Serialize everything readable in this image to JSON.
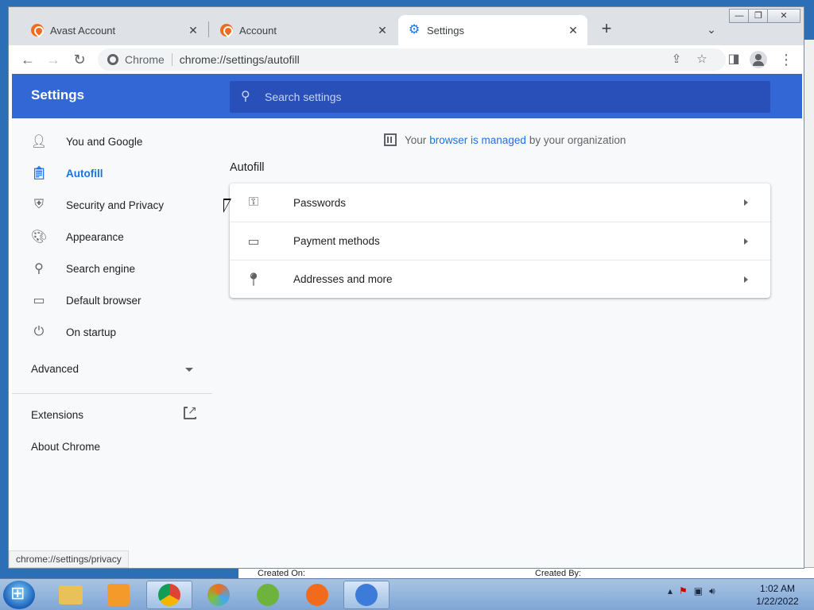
{
  "tabs": [
    {
      "title": "Avast Account",
      "icon": "avast-icon"
    },
    {
      "title": "Account",
      "icon": "avast-icon"
    },
    {
      "title": "Settings",
      "icon": "gear-icon"
    }
  ],
  "omnibox": {
    "site": "Chrome",
    "url": "chrome://settings/autofill"
  },
  "settings": {
    "header_title": "Settings",
    "search_placeholder": "Search settings",
    "managed_pre": "Your",
    "managed_link": "browser is managed",
    "managed_post": "by your organization",
    "section_title": "Autofill"
  },
  "sidebar": {
    "items": [
      {
        "label": "You and Google",
        "icon": "person-icon"
      },
      {
        "label": "Autofill",
        "icon": "clipboard-icon"
      },
      {
        "label": "Security and Privacy",
        "icon": "shield-icon"
      },
      {
        "label": "Appearance",
        "icon": "palette-icon"
      },
      {
        "label": "Search engine",
        "icon": "search-icon"
      },
      {
        "label": "Default browser",
        "icon": "browser-icon"
      },
      {
        "label": "On startup",
        "icon": "power-icon"
      }
    ],
    "advanced": "Advanced",
    "extensions": "Extensions",
    "about": "About Chrome"
  },
  "autofill_rows": [
    {
      "label": "Passwords",
      "icon": "key-icon"
    },
    {
      "label": "Payment methods",
      "icon": "credit-card-icon"
    },
    {
      "label": "Addresses and more",
      "icon": "location-pin-icon"
    }
  ],
  "status_url": "chrome://settings/privacy",
  "background": {
    "created_on": "Created On:",
    "created_by": "Created By:"
  },
  "clock": {
    "time": "1:02 AM",
    "date": "1/22/2022"
  },
  "colors": {
    "header_blue": "#3367d6",
    "active_blue": "#1a73e8"
  }
}
